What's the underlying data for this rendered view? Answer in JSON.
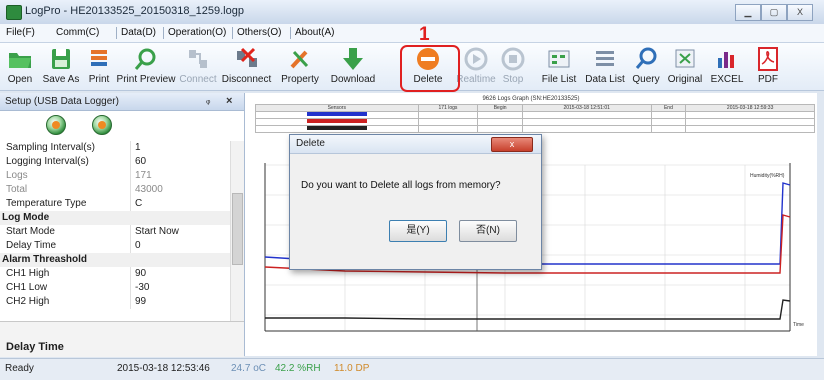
{
  "window": {
    "title": "LogPro - HE20133525_20150318_1259.logp",
    "min_icon": "minimize-icon",
    "max_icon": "maximize-icon",
    "close_label": "X"
  },
  "menu": [
    "File(F)",
    "Comm(C)",
    "Data(D)",
    "Operation(O)",
    "Others(O)",
    "About(A)"
  ],
  "toolbar": [
    {
      "label": "Open",
      "icon": "folder-open-icon",
      "enabled": true
    },
    {
      "label": "Save As",
      "icon": "save-as-icon",
      "enabled": true
    },
    {
      "label": "Print",
      "icon": "print-icon",
      "enabled": true
    },
    {
      "label": "Print Preview",
      "icon": "print-preview-icon",
      "enabled": true
    },
    {
      "label": "Connect",
      "icon": "connect-icon",
      "enabled": false
    },
    {
      "label": "Disconnect",
      "icon": "disconnect-icon",
      "enabled": true
    },
    {
      "label": "Property",
      "icon": "property-icon",
      "enabled": true
    },
    {
      "label": "Download",
      "icon": "download-icon",
      "enabled": true
    },
    {
      "label": "Delete",
      "icon": "delete-icon",
      "enabled": true
    },
    {
      "label": "Realtime",
      "icon": "realtime-icon",
      "enabled": false
    },
    {
      "label": "Stop",
      "icon": "stop-icon",
      "enabled": false
    },
    {
      "label": "File List",
      "icon": "file-list-icon",
      "enabled": true
    },
    {
      "label": "Data List",
      "icon": "data-list-icon",
      "enabled": true
    },
    {
      "label": "Query",
      "icon": "query-icon",
      "enabled": true
    },
    {
      "label": "Original",
      "icon": "original-icon",
      "enabled": true
    },
    {
      "label": "EXCEL",
      "icon": "excel-icon",
      "enabled": true
    },
    {
      "label": "PDF",
      "icon": "pdf-icon",
      "enabled": true
    }
  ],
  "annotation": {
    "step": "1",
    "color": "#e02020"
  },
  "panel": {
    "title": "Setup (USB Data Logger)",
    "pin": "ᵩ",
    "close": "×",
    "properties": [
      {
        "name": "Sampling Interval(s)",
        "value": "1",
        "dim": false
      },
      {
        "name": "Logging Interval(s)",
        "value": "60",
        "dim": false
      },
      {
        "name": "Logs",
        "value": "171",
        "dim": true
      },
      {
        "name": "Total",
        "value": "43000",
        "dim": true
      },
      {
        "name": "Temperature Type",
        "value": "C",
        "dim": false
      },
      {
        "name": "Log Mode",
        "value": "",
        "category": true
      },
      {
        "name": "Start Mode",
        "value": "Start Now",
        "dim": false
      },
      {
        "name": "Delay Time",
        "value": "0",
        "dim": false
      },
      {
        "name": "Alarm Threashold",
        "value": "",
        "category": true
      },
      {
        "name": "CH1 High",
        "value": "90",
        "dim": false
      },
      {
        "name": "CH1 Low",
        "value": "-30",
        "dim": false
      },
      {
        "name": "CH2 High",
        "value": "99",
        "dim": false
      }
    ],
    "description_title": "Delay Time"
  },
  "chart": {
    "heading": "9626 Logs Graph (SN:HE20133525)",
    "table_header": [
      "Sensors",
      "171 logs",
      "Begin",
      "2015-03-18 12:51:01",
      "End",
      "2015-03-18 12:59:33"
    ],
    "series_colors": [
      "#2233cc",
      "#cc2222",
      "#222222"
    ],
    "right_label": "Humidity(%RH)",
    "time_label": "Time"
  },
  "dialog": {
    "title": "Delete",
    "close_label": "x",
    "message": "Do you want to Delete all logs from memory?",
    "yes_label": "是(Y)",
    "no_label": "否(N)"
  },
  "status": {
    "ready": "Ready",
    "datetime": "2015-03-18 12:53:46",
    "temperature": "24.7 oC",
    "humidity": "42.2 %RH",
    "dewpoint": "11.0 DP"
  }
}
